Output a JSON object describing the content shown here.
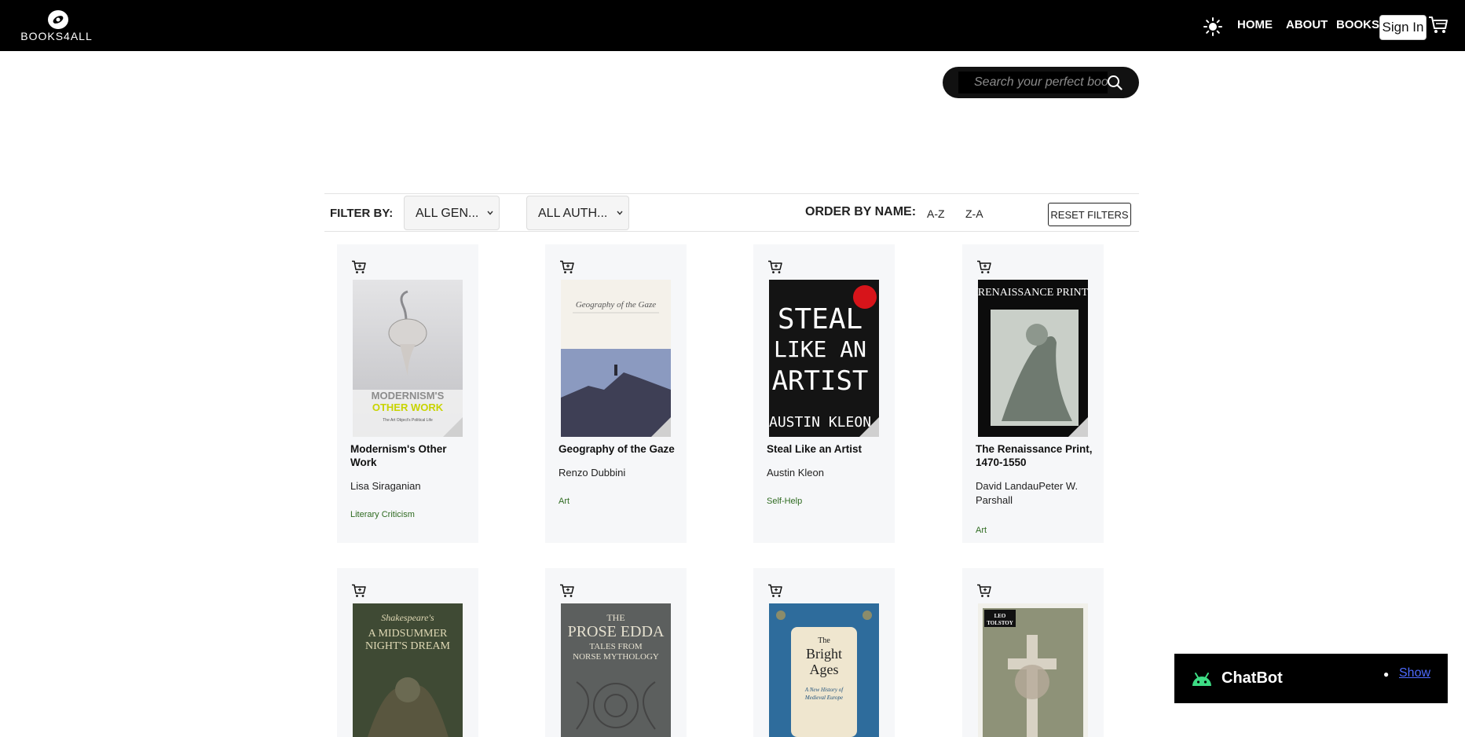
{
  "nav": {
    "brand": "BOOKS4ALL",
    "links": {
      "home": "HOME",
      "about": "ABOUT",
      "books": "BOOKS"
    },
    "signin_label": "Sign In",
    "icons": {
      "theme": "sun-icon",
      "cart": "cart-icon",
      "logo": "eye-logo-icon"
    }
  },
  "search": {
    "placeholder": "Search your perfect book",
    "icon": "search-icon"
  },
  "filters": {
    "filter_label": "FILTER BY:",
    "genre_selected": "ALL GEN...",
    "author_selected": "ALL AUTH...",
    "order_label": "ORDER BY NAME:",
    "sort_az": "A-Z",
    "sort_za": "Z-A",
    "reset_label": "RESET FILTERS"
  },
  "books": [
    {
      "title": "Modernism's Other Work",
      "author": "Lisa Siraganian",
      "genre": "Literary Criticism",
      "cover_text": "MODERNISM'S OTHER WORK"
    },
    {
      "title": "Geography of the Gaze",
      "author": "Renzo Dubbini",
      "genre": "Art",
      "cover_text": "Geography of the Gaze"
    },
    {
      "title": "Steal Like an Artist",
      "author": "Austin Kleon",
      "genre": "Self-Help",
      "cover_text": "STEAL LIKE AN ARTIST"
    },
    {
      "title": "The Renaissance Print, 1470-1550",
      "author": "David LandauPeter W. Parshall",
      "genre": "Art",
      "cover_text": "THE RENAISSANCE PRINT"
    },
    {
      "title": "",
      "author": "",
      "genre": "",
      "cover_text": "A MIDSUMMER NIGHT'S DREAM"
    },
    {
      "title": "",
      "author": "",
      "genre": "",
      "cover_text": "THE PROSE EDDA"
    },
    {
      "title": "",
      "author": "",
      "genre": "",
      "cover_text": "THE BRIGHT AGES"
    },
    {
      "title": "",
      "author": "",
      "genre": "",
      "cover_text": "LEO TOLSTOY"
    }
  ],
  "chatbot": {
    "title": "ChatBot",
    "show_label": "Show",
    "icon": "android-icon"
  },
  "colors": {
    "nav_bg": "#000000",
    "card_bg": "#f6f7f9",
    "genre_text": "#2f6b21",
    "link": "#4e6bff"
  }
}
